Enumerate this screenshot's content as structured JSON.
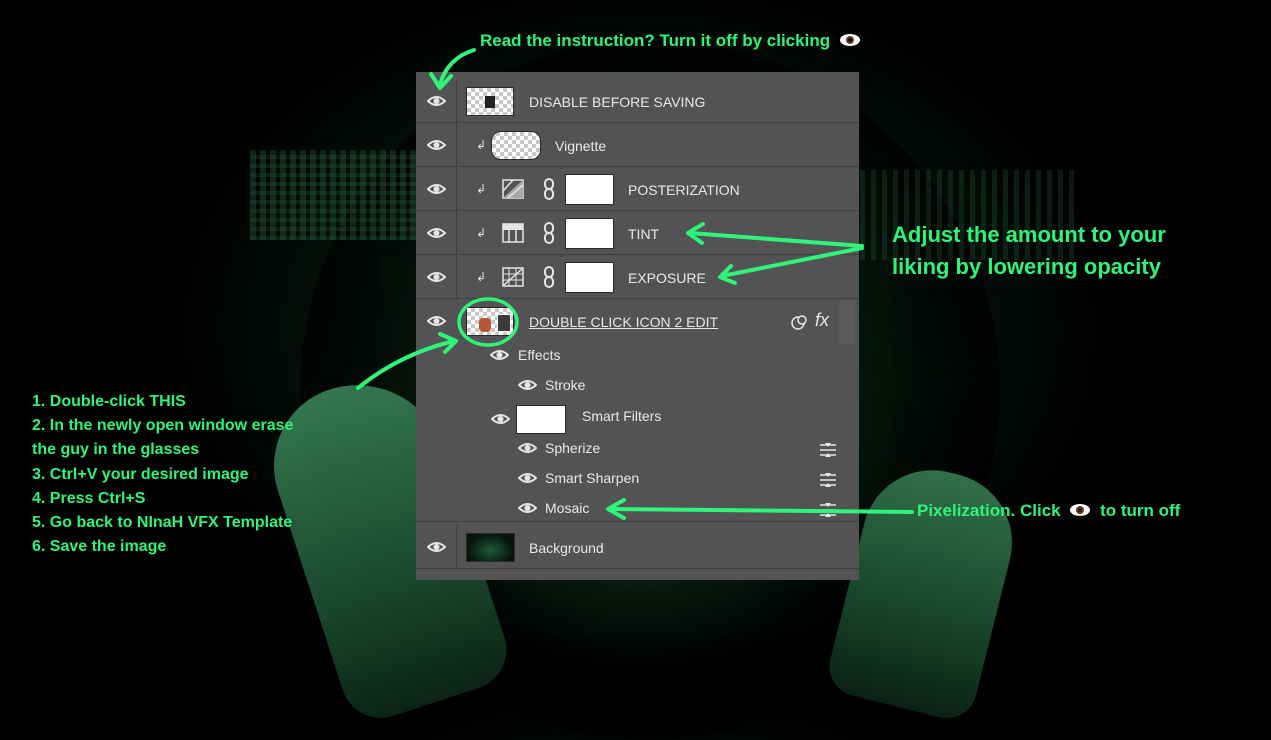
{
  "annotations": {
    "top": "Read the instruction? Turn it off by clicking",
    "top_icon": "eye-emoji-icon",
    "adjust_line1": "Adjust the amount to your",
    "adjust_line2": "liking by lowering opacity",
    "pixelization_before": "Pixelization. Click",
    "pixelization_after": "to turn off",
    "steps": [
      "1. Double-click THIS",
      "2. In the newly open window erase",
      "the guy in the glasses",
      "3. Ctrl+V your desired image",
      "4. Press Ctrl+S",
      "5. Go back to NInaH VFX Template",
      "6. Save the image"
    ]
  },
  "layers": [
    {
      "name": "DISABLE BEFORE SAVING",
      "visible": true,
      "thumb": "checker",
      "clipped": false
    },
    {
      "name": "Vignette",
      "visible": true,
      "thumb": "checker",
      "clipped": true
    },
    {
      "name": "POSTERIZATION",
      "visible": true,
      "thumb": "adjustment-posterize",
      "clipped": true,
      "mask": true
    },
    {
      "name": "TINT",
      "visible": true,
      "thumb": "adjustment-color-balance",
      "clipped": true,
      "mask": true
    },
    {
      "name": "EXPOSURE",
      "visible": true,
      "thumb": "adjustment-exposure",
      "clipped": true,
      "mask": true
    },
    {
      "name": "DOUBLE CLICK ICON 2 EDIT",
      "visible": true,
      "thumb": "smart-object",
      "clipped": false,
      "fx": "fx"
    },
    {
      "name": "Background",
      "visible": true,
      "thumb": "dark-image",
      "clipped": false
    }
  ],
  "effects": {
    "effects_label": "Effects",
    "stroke_label": "Stroke",
    "smart_filters_label": "Smart Filters",
    "filters": [
      "Spherize",
      "Smart Sharpen",
      "Mosaic"
    ]
  },
  "colors": {
    "annotation": "#2ef47a",
    "panel": "#535353",
    "panel_border": "#3f3f3f"
  }
}
